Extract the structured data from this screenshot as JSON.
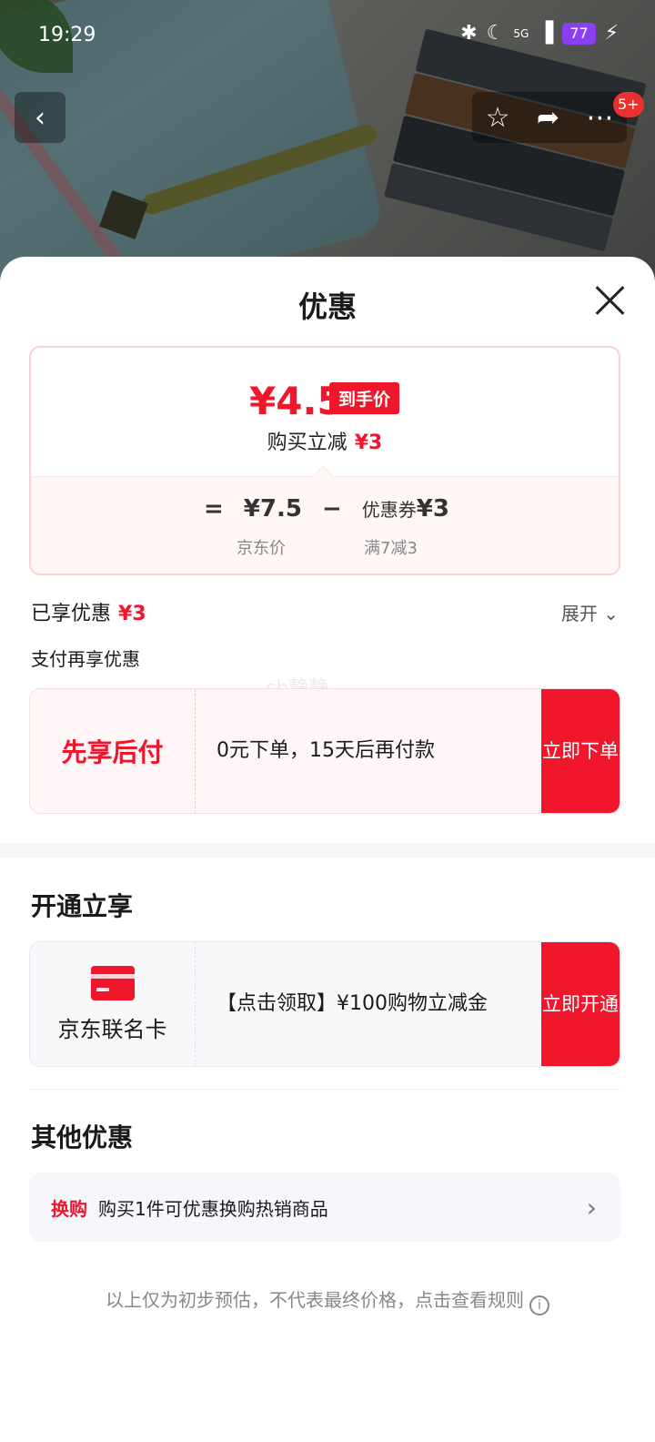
{
  "status_bar": {
    "time": "19:29",
    "bluetooth_icon": "bluetooth-icon",
    "moon_icon": "moon-icon",
    "network": "5G",
    "battery": "77",
    "charging_icon": "lightning-icon"
  },
  "nav": {
    "back_icon": "chevron-left-icon",
    "star_icon": "star-icon",
    "share_icon": "share-icon",
    "more_icon": "more-icon",
    "badge": "5+"
  },
  "sheet": {
    "title": "优惠",
    "price": {
      "final_price": "¥4.5",
      "final_tag": "到手价",
      "reduce_label": "购买立减",
      "reduce_amount": "¥3",
      "equals": "=",
      "jd_price": "¥7.5",
      "minus": "−",
      "coupon_label": "优惠券",
      "coupon_amount": "¥3",
      "jd_price_label": "京东价",
      "coupon_rule": "满7减3"
    },
    "enjoyed_label": "已享优惠",
    "enjoyed_amount": "¥3",
    "expand_label": "展开",
    "pay_more_label": "支付再享优惠",
    "watermark": "sh静静",
    "bnpl": {
      "title": "先享后付",
      "desc": "0元下单，15天后再付款",
      "cta": "立即下单"
    },
    "open_section_title": "开通立享",
    "card_offer": {
      "icon": "credit-card-icon",
      "name": "京东联名卡",
      "desc": "【点击领取】¥100购物立减金",
      "cta": "立即开通"
    },
    "other_section_title": "其他优惠",
    "exchange": {
      "tag": "换购",
      "desc": "购买1件可优惠换购热销商品"
    },
    "footnote": "以上仅为初步预估，不代表最终价格，点击查看规则"
  },
  "colors": {
    "accent_red": "#f0162c",
    "battery_purple": "#8a3ff0"
  }
}
